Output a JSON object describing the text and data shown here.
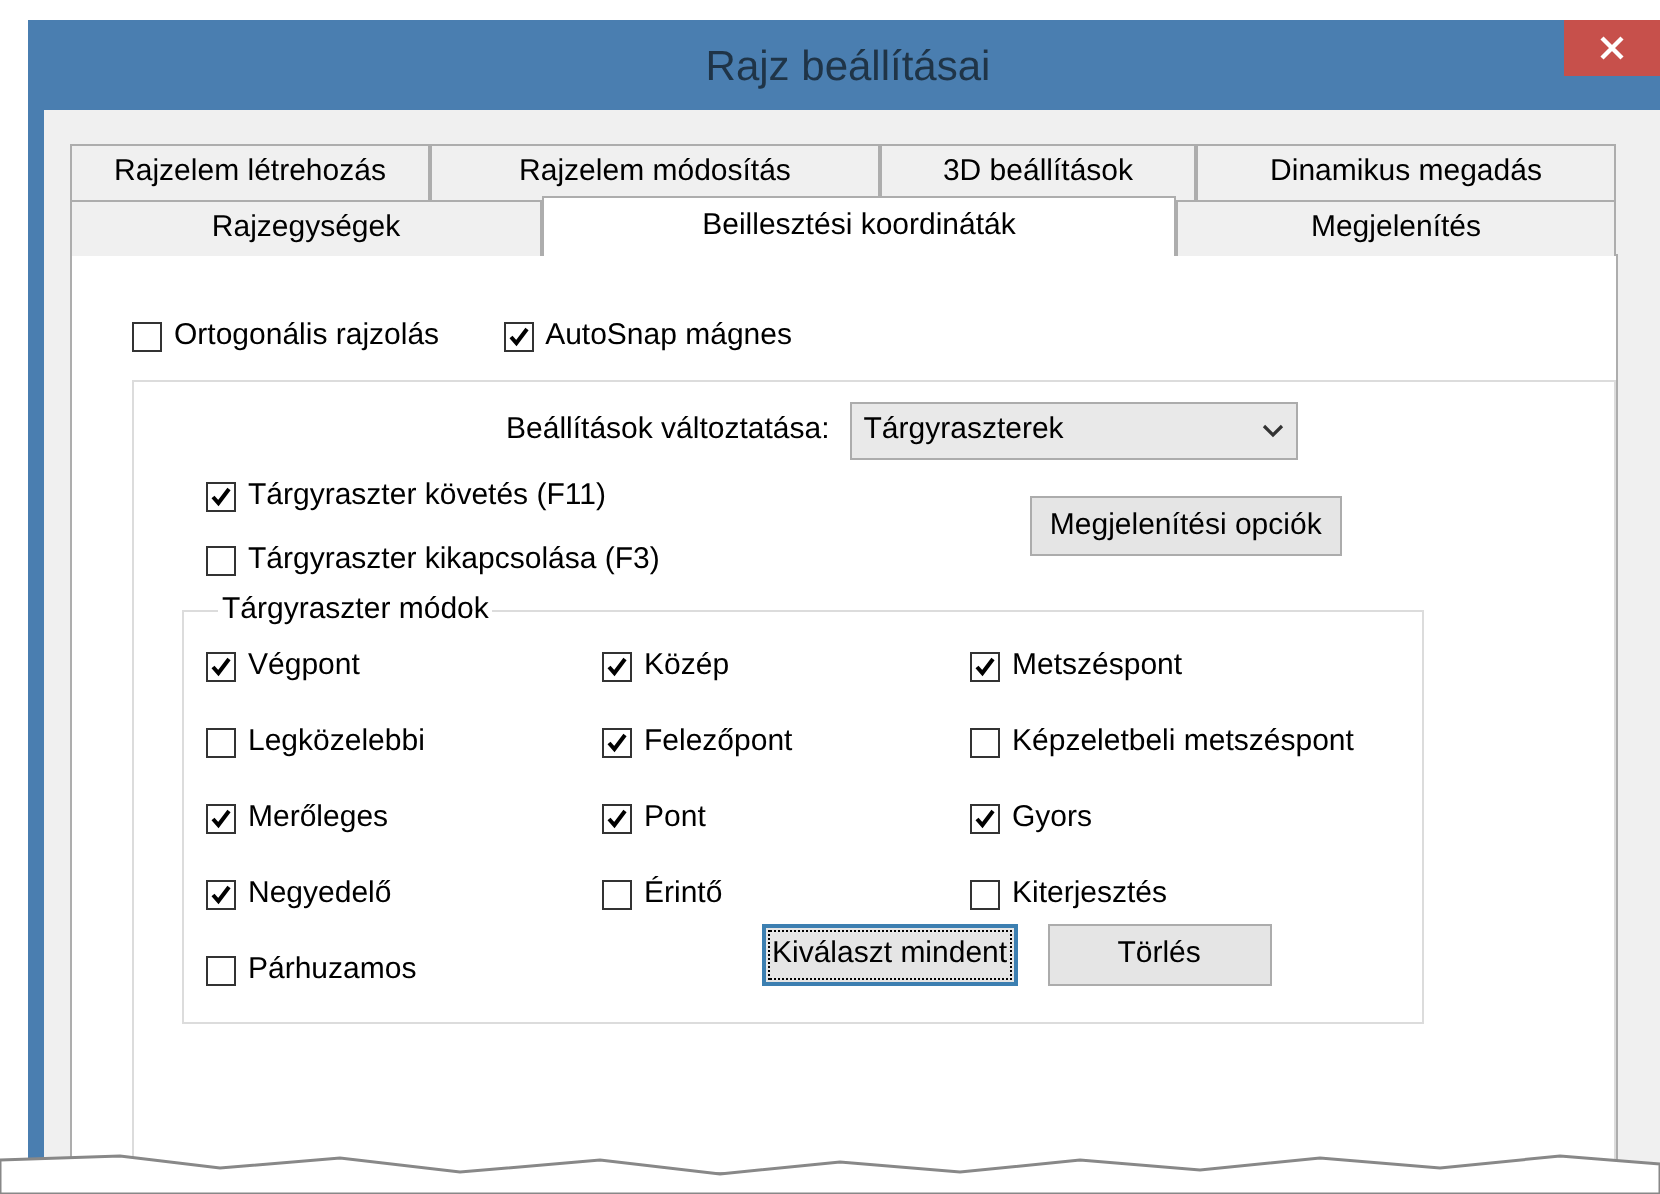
{
  "window": {
    "title": "Rajz beállításai"
  },
  "tabs": [
    [
      {
        "label": "Rajzelem létrehozás",
        "selected": false
      },
      {
        "label": "Rajzelem módosítás",
        "selected": false
      },
      {
        "label": "3D beállítások",
        "selected": false
      },
      {
        "label": "Dinamikus megadás",
        "selected": false
      }
    ],
    [
      {
        "label": "Rajzegységek",
        "selected": false
      },
      {
        "label": "Beillesztési koordináták",
        "selected": true
      },
      {
        "label": "Megjelenítés",
        "selected": false
      }
    ]
  ],
  "top_options": [
    {
      "label": "Ortogonális rajzolás",
      "checked": false
    },
    {
      "label": "AutoSnap mágnes",
      "checked": true
    }
  ],
  "settings_dropdown": {
    "label": "Beállítások változtatása:",
    "value": "Tárgyraszterek"
  },
  "tracking_options": [
    {
      "label": "Tárgyraszter követés (F11)",
      "checked": true
    },
    {
      "label": "Tárgyraszter kikapcsolása (F3)",
      "checked": false
    }
  ],
  "display_options_button": "Megjelenítési opciók",
  "modes": {
    "title": "Tárgyraszter módok",
    "items": [
      {
        "label": "Végpont",
        "checked": true
      },
      {
        "label": "Közép",
        "checked": true
      },
      {
        "label": "Metszéspont",
        "checked": true
      },
      {
        "label": "Legközelebbi",
        "checked": false
      },
      {
        "label": "Felezőpont",
        "checked": true
      },
      {
        "label": "Képzeletbeli metszéspont",
        "checked": false
      },
      {
        "label": "Merőleges",
        "checked": true
      },
      {
        "label": "Pont",
        "checked": true
      },
      {
        "label": "Gyors",
        "checked": true
      },
      {
        "label": "Negyedelő",
        "checked": true
      },
      {
        "label": "Érintő",
        "checked": false
      },
      {
        "label": "Kiterjesztés",
        "checked": false
      },
      {
        "label": "Párhuzamos",
        "checked": false
      }
    ],
    "buttons": [
      {
        "label": "Kiválaszt mindent",
        "focused": true
      },
      {
        "label": "Törlés",
        "focused": false
      }
    ]
  }
}
